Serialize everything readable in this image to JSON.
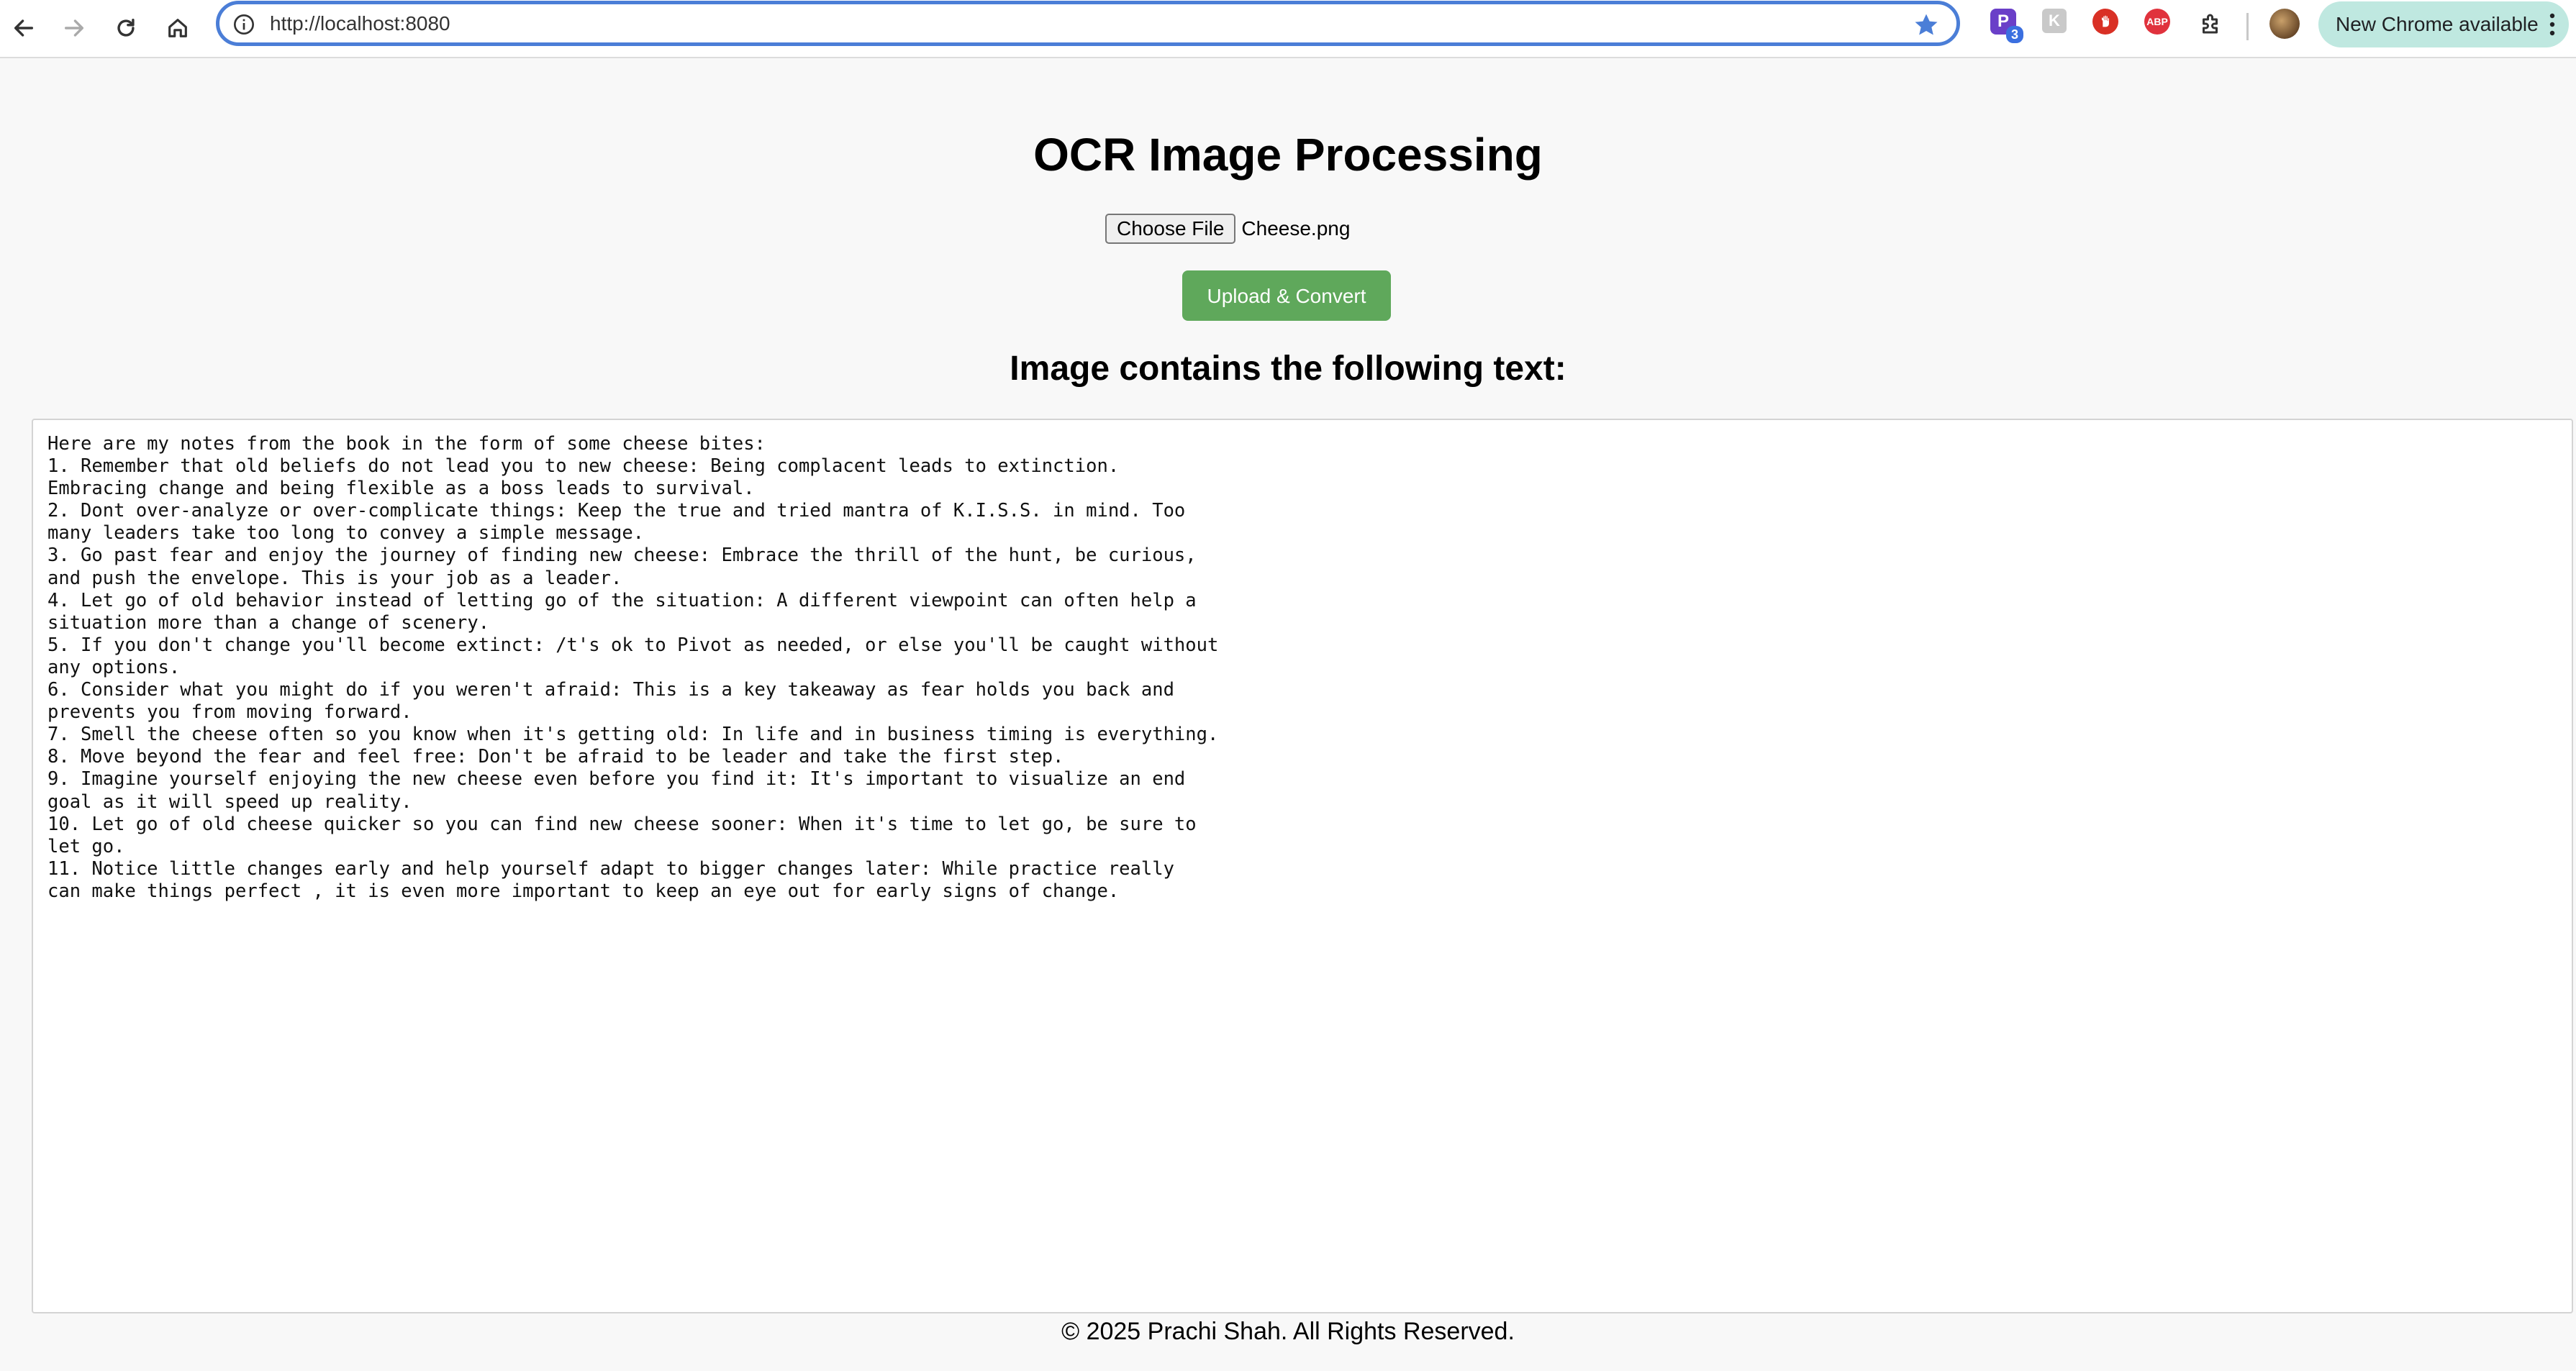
{
  "browser": {
    "url": "http://localhost:8080",
    "extension_badge": "3",
    "extension_p_label": "P",
    "extension_k_label": "K",
    "extension_abp_label": "ABP",
    "update_label": "New Chrome available"
  },
  "page": {
    "title": "OCR Image Processing",
    "choose_file_label": "Choose File",
    "file_name": "Cheese.png",
    "upload_label": "Upload & Convert",
    "result_heading": "Image contains the following text:",
    "result_text": "Here are my notes from the book in the form of some cheese bites:\n1. Remember that old beliefs do not lead you to new cheese: Being complacent leads to extinction.\nEmbracing change and being flexible as a boss leads to survival.\n2. Dont over-analyze or over-complicate things: Keep the true and tried mantra of K.I.S.S. in mind. Too\nmany leaders take too long to convey a simple message.\n3. Go past fear and enjoy the journey of finding new cheese: Embrace the thrill of the hunt, be curious,\nand push the envelope. This is your job as a leader.\n4. Let go of old behavior instead of letting go of the situation: A different viewpoint can often help a\nsituation more than a change of scenery.\n5. If you don't change you'll become extinct: /t's ok to Pivot as needed, or else you'll be caught without\nany options.\n6. Consider what you might do if you weren't afraid: This is a key takeaway as fear holds you back and\nprevents you from moving forward.\n7. Smell the cheese often so you know when it's getting old: In life and in business timing is everything.\n8. Move beyond the fear and feel free: Don't be afraid to be leader and take the first step.\n9. Imagine yourself enjoying the new cheese even before you find it: It's important to visualize an end\ngoal as it will speed up reality.\n10. Let go of old cheese quicker so you can find new cheese sooner: When it's time to let go, be sure to\nlet go.\n11. Notice little changes early and help yourself adapt to bigger changes later: While practice really\ncan make things perfect , it is even more important to keep an eye out for early signs of change."
  },
  "footer": {
    "text": "© 2025 Prachi Shah. All Rights Reserved."
  },
  "colors": {
    "upload_button": "#5fa85b",
    "omnibox_focus": "#4b7ed7",
    "update_pill": "#bfe8e0"
  }
}
